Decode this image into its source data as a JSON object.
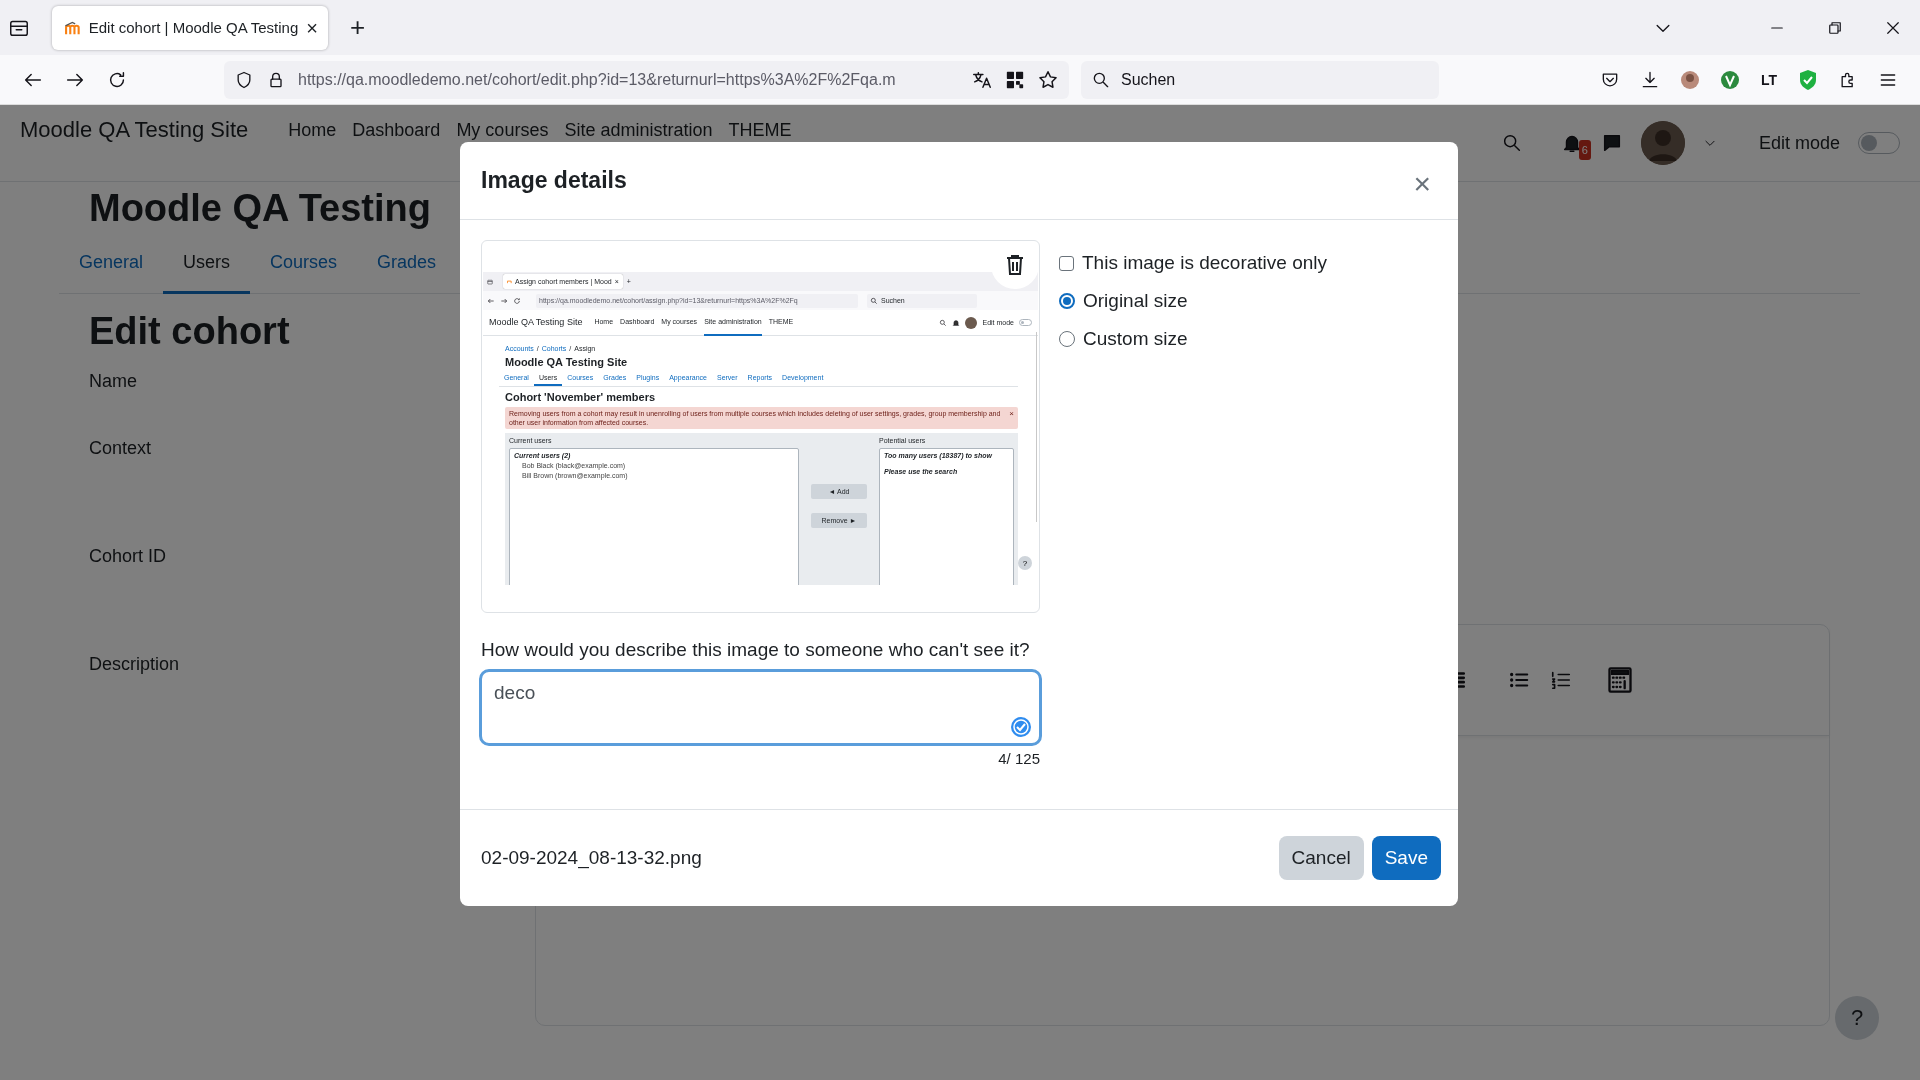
{
  "browser": {
    "tab": {
      "title": "Edit cohort | Moodle QA Testing",
      "close": "×"
    },
    "new_tab": "+",
    "address": "https://qa.moodledemo.net/cohort/edit.php?id=13&returnurl=https%3A%2F%2Fqa.m",
    "search": {
      "placeholder": "Suchen"
    },
    "extension_label": "LT"
  },
  "navbar": {
    "site_name": "Moodle QA Testing Site",
    "items": [
      {
        "label": "Home"
      },
      {
        "label": "Dashboard"
      },
      {
        "label": "My courses"
      },
      {
        "label": "Site administration"
      },
      {
        "label": "THEME"
      }
    ],
    "notification_count": "6",
    "edit_mode": {
      "label": "Edit mode",
      "on": false
    }
  },
  "page": {
    "site_heading": "Moodle QA Testing",
    "tabs": [
      {
        "label": "General",
        "selected": false
      },
      {
        "label": "Users",
        "selected": true
      },
      {
        "label": "Courses",
        "selected": false
      },
      {
        "label": "Grades",
        "selected": false
      }
    ],
    "title": "Edit cohort",
    "fields": [
      {
        "label": "Name"
      },
      {
        "label": "Context"
      },
      {
        "label": "Cohort ID"
      },
      {
        "label": "Description"
      }
    ],
    "help": "?"
  },
  "modal": {
    "title": "Image details",
    "close": "×",
    "preview": {
      "tab": "Assign cohort members | Mood",
      "tab_close": "×",
      "new_tab": "+",
      "address": "https://qa.moodledemo.net/cohort/assign.php?id=13&returnurl=https%3A%2F%2Fq",
      "search": "Suchen",
      "site_name": "Moodle QA Testing Site",
      "nav": [
        {
          "label": "Home",
          "selected": false
        },
        {
          "label": "Dashboard",
          "selected": false
        },
        {
          "label": "My courses",
          "selected": false
        },
        {
          "label": "Site administration",
          "selected": true
        },
        {
          "label": "THEME",
          "selected": false
        }
      ],
      "edit_mode": {
        "label": "Edit mode",
        "on": false
      },
      "breadcrumb": [
        {
          "label": "Accounts"
        },
        {
          "label": "Cohorts"
        },
        {
          "label": "Assign"
        }
      ],
      "breadcrumb_separator": "/",
      "heading": "Moodle QA Testing Site",
      "tabs": [
        {
          "label": "General",
          "selected": false
        },
        {
          "label": "Users",
          "selected": true
        },
        {
          "label": "Courses",
          "selected": false
        },
        {
          "label": "Grades",
          "selected": false
        },
        {
          "label": "Plugins",
          "selected": false
        },
        {
          "label": "Appearance",
          "selected": false
        },
        {
          "label": "Server",
          "selected": false
        },
        {
          "label": "Reports",
          "selected": false
        },
        {
          "label": "Development",
          "selected": false
        }
      ],
      "title": "Cohort 'November' members",
      "alert": "Removing users from a cohort may result in unenrolling of users from multiple courses which includes deleting of user settings, grades, group membership and other user information from affected courses.",
      "alert_close": "×",
      "current": {
        "label": "Current users",
        "group": "Current users (2)",
        "users": [
          "Bob Black (black@example.com)",
          "Bill Brown (brown@example.com)"
        ]
      },
      "add": "◄ Add",
      "remove": "Remove ►",
      "potential": {
        "label": "Potential users",
        "lines": [
          "Too many users (18387) to show",
          "Please use the search"
        ]
      },
      "help": "?"
    },
    "decorative": {
      "label": "This image is decorative only",
      "checked": false
    },
    "size_options": [
      {
        "label": "Original size",
        "selected": true
      },
      {
        "label": "Custom size",
        "selected": false
      }
    ],
    "description": {
      "label": "How would you describe this image to someone who can't see it?",
      "value": "deco",
      "counter": "4/ 125"
    },
    "filename": "02-09-2024_08-13-32.png",
    "buttons": [
      {
        "label": "Cancel",
        "kind": "secondary"
      },
      {
        "label": "Save",
        "kind": "primary"
      }
    ]
  }
}
